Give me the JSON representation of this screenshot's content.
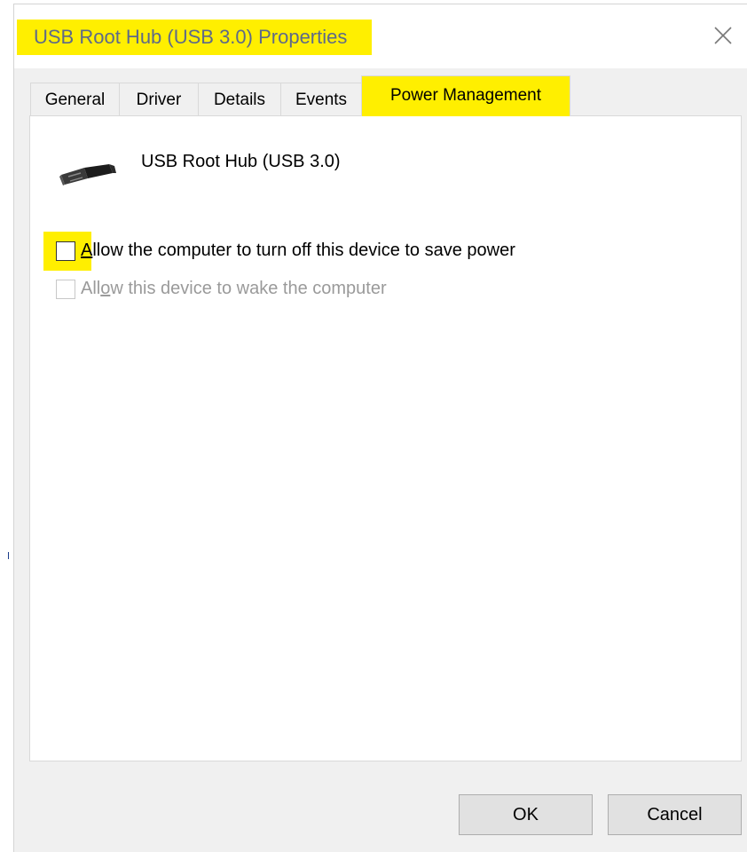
{
  "window": {
    "title": "USB Root Hub (USB 3.0) Properties",
    "close_icon": "close-icon"
  },
  "tabs": [
    {
      "label": "General",
      "active": false
    },
    {
      "label": "Driver",
      "active": false
    },
    {
      "label": "Details",
      "active": false
    },
    {
      "label": "Events",
      "active": false
    },
    {
      "label": "Power Management",
      "active": true
    }
  ],
  "device": {
    "icon": "usb-plug-icon",
    "name": "USB Root Hub (USB 3.0)"
  },
  "options": [
    {
      "label": "Allow the computer to turn off this device to save power",
      "mnemonic": "A",
      "checked": false,
      "enabled": true
    },
    {
      "label": "Allow this device to wake the computer",
      "mnemonic": "o",
      "checked": false,
      "enabled": false
    }
  ],
  "buttons": {
    "ok": "OK",
    "cancel": "Cancel"
  },
  "colors": {
    "highlight": "#ffef00",
    "title_text": "#5e6a89",
    "dialog_background": "#f0f0f0",
    "disabled_text": "#9a9a9a"
  }
}
